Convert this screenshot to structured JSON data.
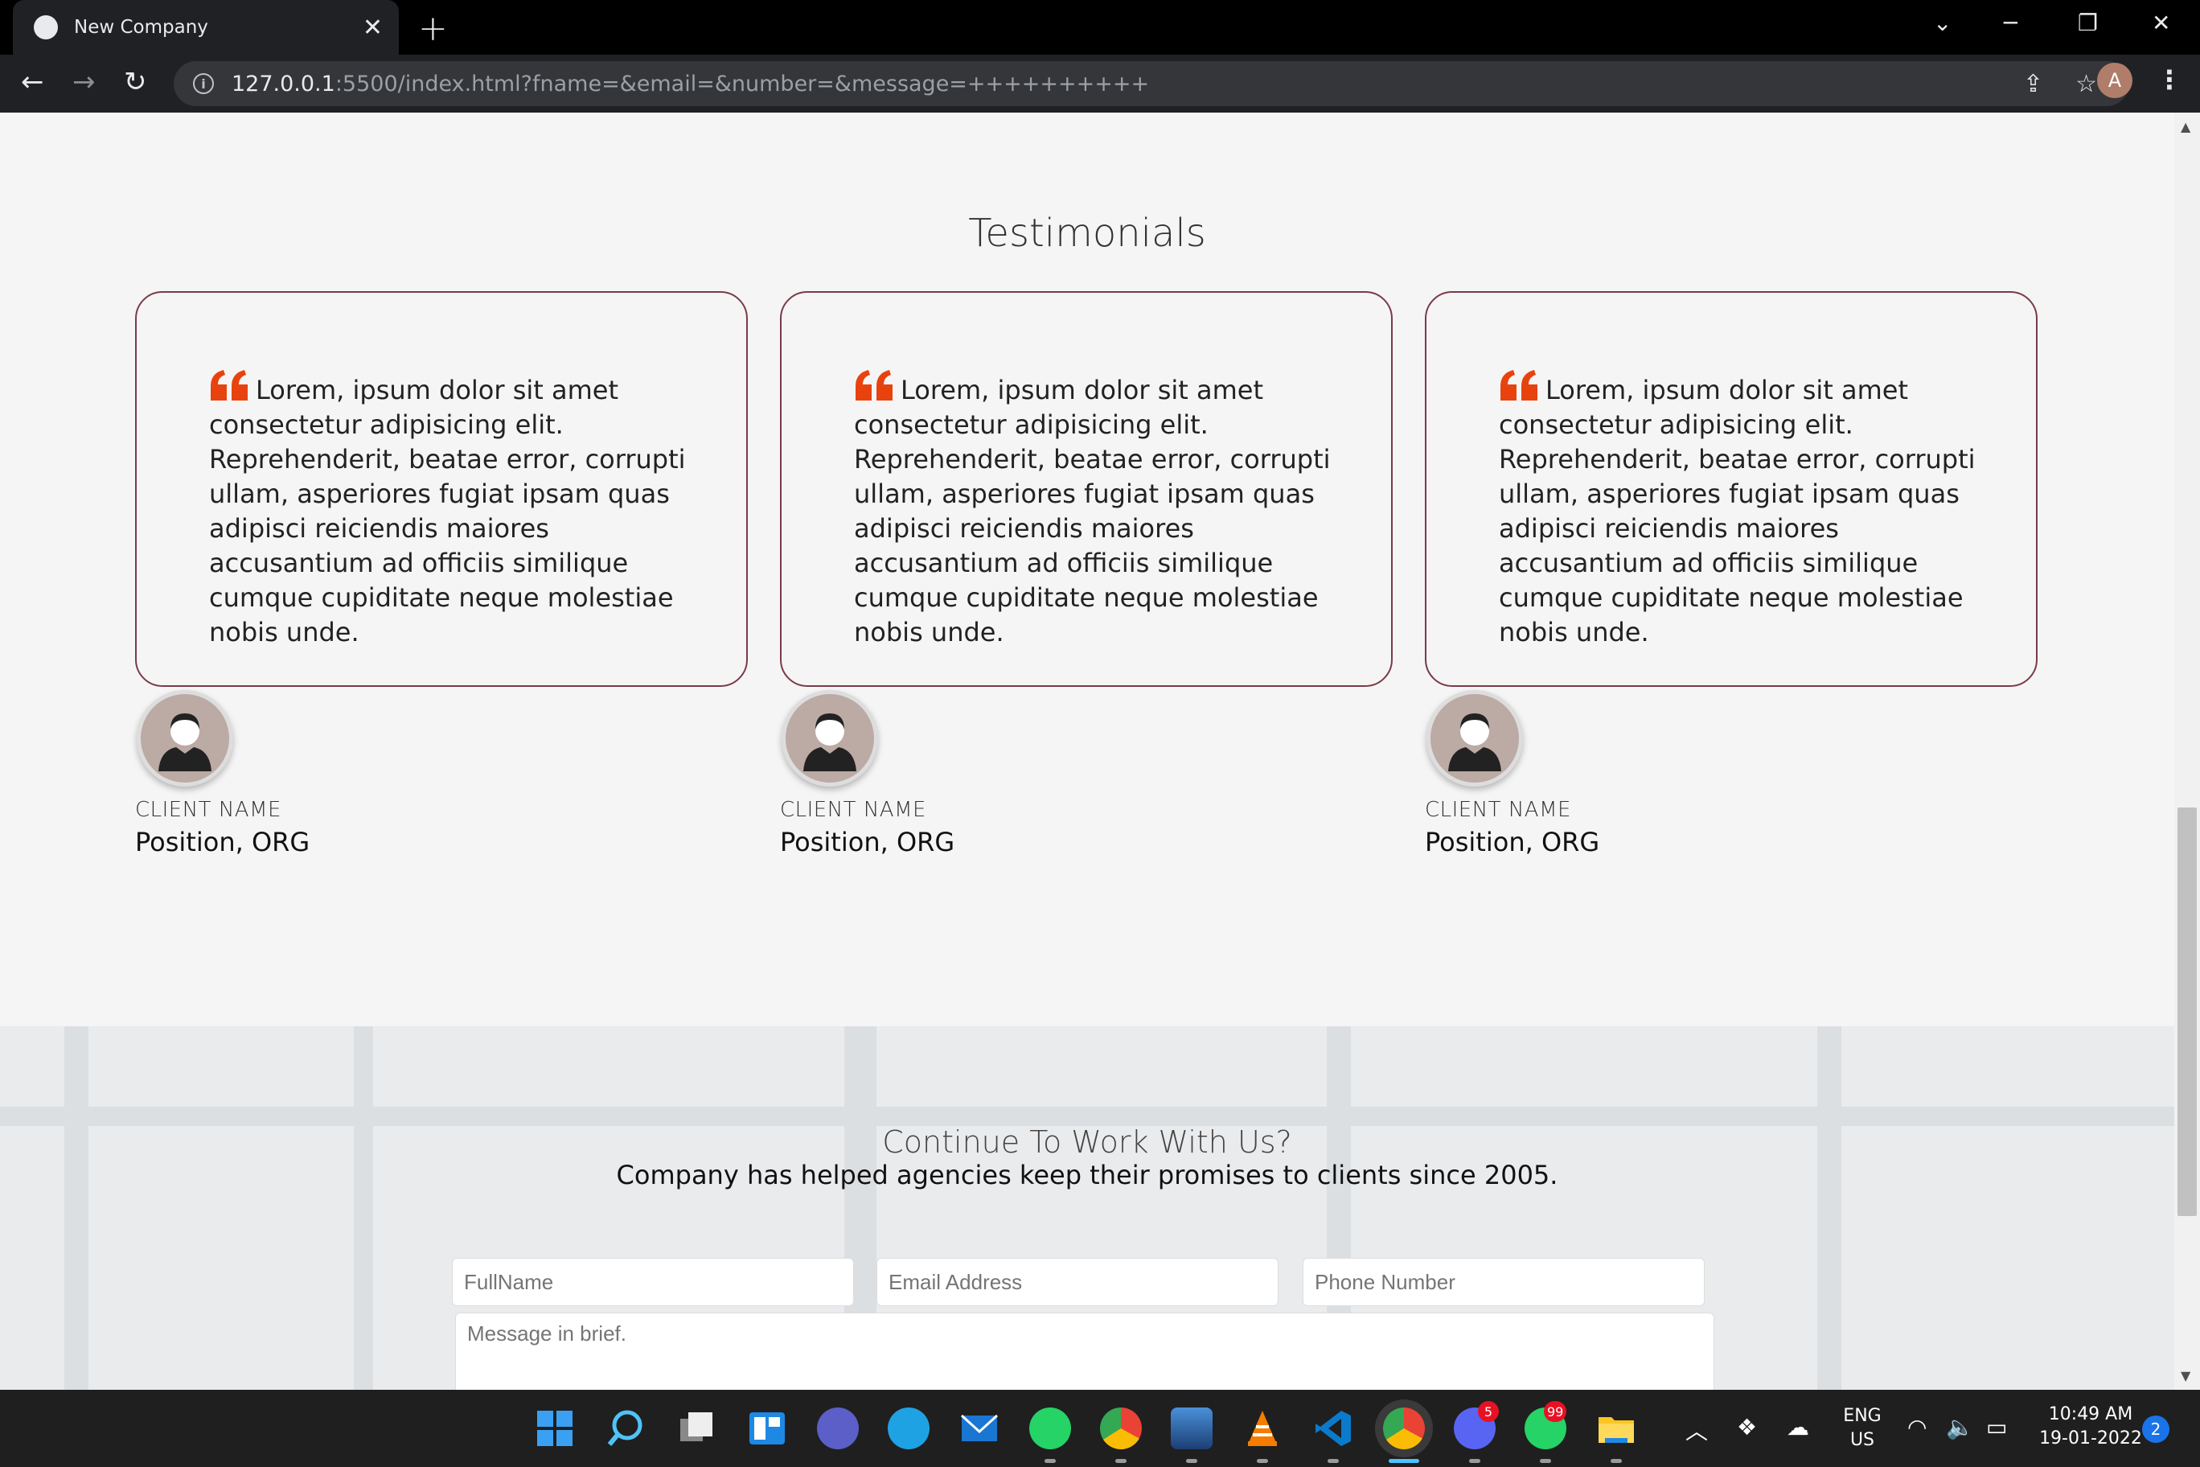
{
  "browser": {
    "tab_title": "New Company",
    "tab_close": "✕",
    "new_tab": "+",
    "url_host": "127.0.0.1",
    "url_rest": ":5500/index.html?fname=&email=&number=&message=++++++++++",
    "profile_initial": "A"
  },
  "testimonials": {
    "title": "Testimonials",
    "items": [
      {
        "quote": "Lorem, ipsum dolor sit amet consectetur adipisicing elit. Reprehenderit, beatae error, corrupti ullam, asperiores fugiat ipsam quas adipisci reiciendis maiores accusantium ad officiis similique cumque cupiditate neque molestiae nobis unde.",
        "client_name": "CLIENT NAME",
        "position": "Position, ORG"
      },
      {
        "quote": "Lorem, ipsum dolor sit amet consectetur adipisicing elit. Reprehenderit, beatae error, corrupti ullam, asperiores fugiat ipsam quas adipisci reiciendis maiores accusantium ad officiis similique cumque cupiditate neque molestiae nobis unde.",
        "client_name": "CLIENT NAME",
        "position": "Position, ORG"
      },
      {
        "quote": "Lorem, ipsum dolor sit amet consectetur adipisicing elit. Reprehenderit, beatae error, corrupti ullam, asperiores fugiat ipsam quas adipisci reiciendis maiores accusantium ad officiis similique cumque cupiditate neque molestiae nobis unde.",
        "client_name": "CLIENT NAME",
        "position": "Position, ORG"
      }
    ],
    "quote_color": "#e8430f"
  },
  "contact": {
    "title": "Continue To Work With Us?",
    "subtitle": "Company has helped agencies keep their promises to clients since 2005.",
    "fullname_placeholder": "FullName",
    "email_placeholder": "Email Address",
    "phone_placeholder": "Phone Number",
    "message_placeholder": "Message in brief."
  },
  "taskbar": {
    "lang_top": "ENG",
    "lang_bottom": "US",
    "time": "10:49 AM",
    "date": "19-01-2022",
    "notification_count": "2",
    "discord_badge": "5",
    "whatsapp_badge": "99"
  }
}
